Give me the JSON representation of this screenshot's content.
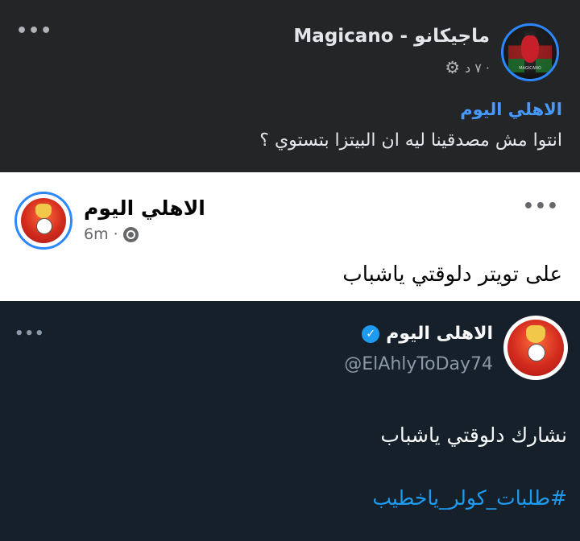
{
  "top_post": {
    "author": "Magicano - ماجيكانو",
    "time": "٧ د ·",
    "privacy_icon": "gear-icon",
    "more_label": "•••",
    "avatar_caption": "MAGICANO",
    "shared_from": "الاهلي اليوم",
    "message": "انتوا مش مصدقينا ليه ان البيتزا بتستوي ؟"
  },
  "shared_card": {
    "page_name": "الاهلي اليوم",
    "time": "6m",
    "separator": "·",
    "privacy_icon": "globe-icon",
    "more_label": "•••",
    "message": "على تويتر دلوقتي ياشباب"
  },
  "tweet": {
    "display_name": "الاهلى اليوم",
    "verified_icon": "verified-badge-icon",
    "verified_glyph": "✓",
    "handle": "@ElAhlyToDay74",
    "more_label": "•••",
    "message": "نشارك دلوقتي ياشباب",
    "hashtag": "#طلبات_كولر_ياخطيب"
  },
  "colors": {
    "facebook_dark_bg": "#242526",
    "twitter_dark_bg": "#15202b",
    "link_blue": "#4599ff",
    "twitter_blue": "#1d9bf0"
  }
}
